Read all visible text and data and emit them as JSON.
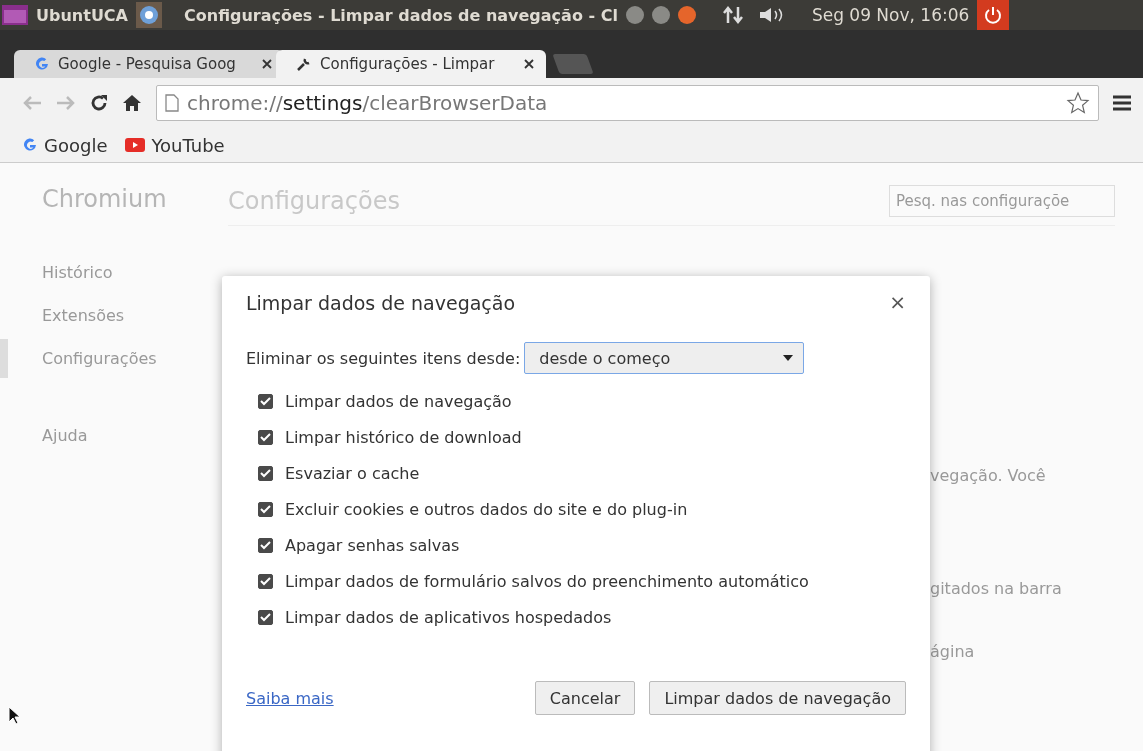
{
  "top_panel": {
    "app_name": "UbuntUCA",
    "window_title": "Configurações - Limpar dados de navegação - Cl",
    "clock": "Seg 09 Nov, 16:06"
  },
  "tabs": [
    {
      "label": "Google - Pesquisa Goog",
      "selected": false,
      "kind": "google"
    },
    {
      "label": "Configurações - Limpar",
      "selected": true,
      "kind": "settings"
    }
  ],
  "address_bar": {
    "scheme": "chrome://",
    "host": "settings",
    "path": "/clearBrowserData"
  },
  "bookmarks": [
    {
      "label": "Google",
      "kind": "google"
    },
    {
      "label": "YouTube",
      "kind": "youtube"
    }
  ],
  "sidebar": {
    "title": "Chromium",
    "items": [
      {
        "label": "Histórico",
        "selected": false
      },
      {
        "label": "Extensões",
        "selected": false
      },
      {
        "label": "Configurações",
        "selected": true
      },
      {
        "label": "Ajuda",
        "selected": false
      }
    ]
  },
  "settings": {
    "title": "Configurações",
    "search_placeholder": "Pesq. nas configuraçõe",
    "background_texts": [
      "vegação. Você",
      "gitados na barra",
      "ágina"
    ]
  },
  "dialog": {
    "title": "Limpar dados de navegação",
    "close": "×",
    "period_label": "Eliminar os seguintes itens desde:",
    "period_value": "desde o começo",
    "options": [
      {
        "label": "Limpar dados de navegação",
        "checked": true
      },
      {
        "label": "Limpar histórico de download",
        "checked": true
      },
      {
        "label": "Esvaziar o cache",
        "checked": true
      },
      {
        "label": "Excluir cookies e outros dados do site e do plug-in",
        "checked": true
      },
      {
        "label": "Apagar senhas salvas",
        "checked": true
      },
      {
        "label": "Limpar dados de formulário salvos do preenchimento automático",
        "checked": true
      },
      {
        "label": "Limpar dados de aplicativos hospedados",
        "checked": true
      }
    ],
    "learn_more": "Saiba mais",
    "cancel": "Cancelar",
    "confirm": "Limpar dados de navegação"
  }
}
